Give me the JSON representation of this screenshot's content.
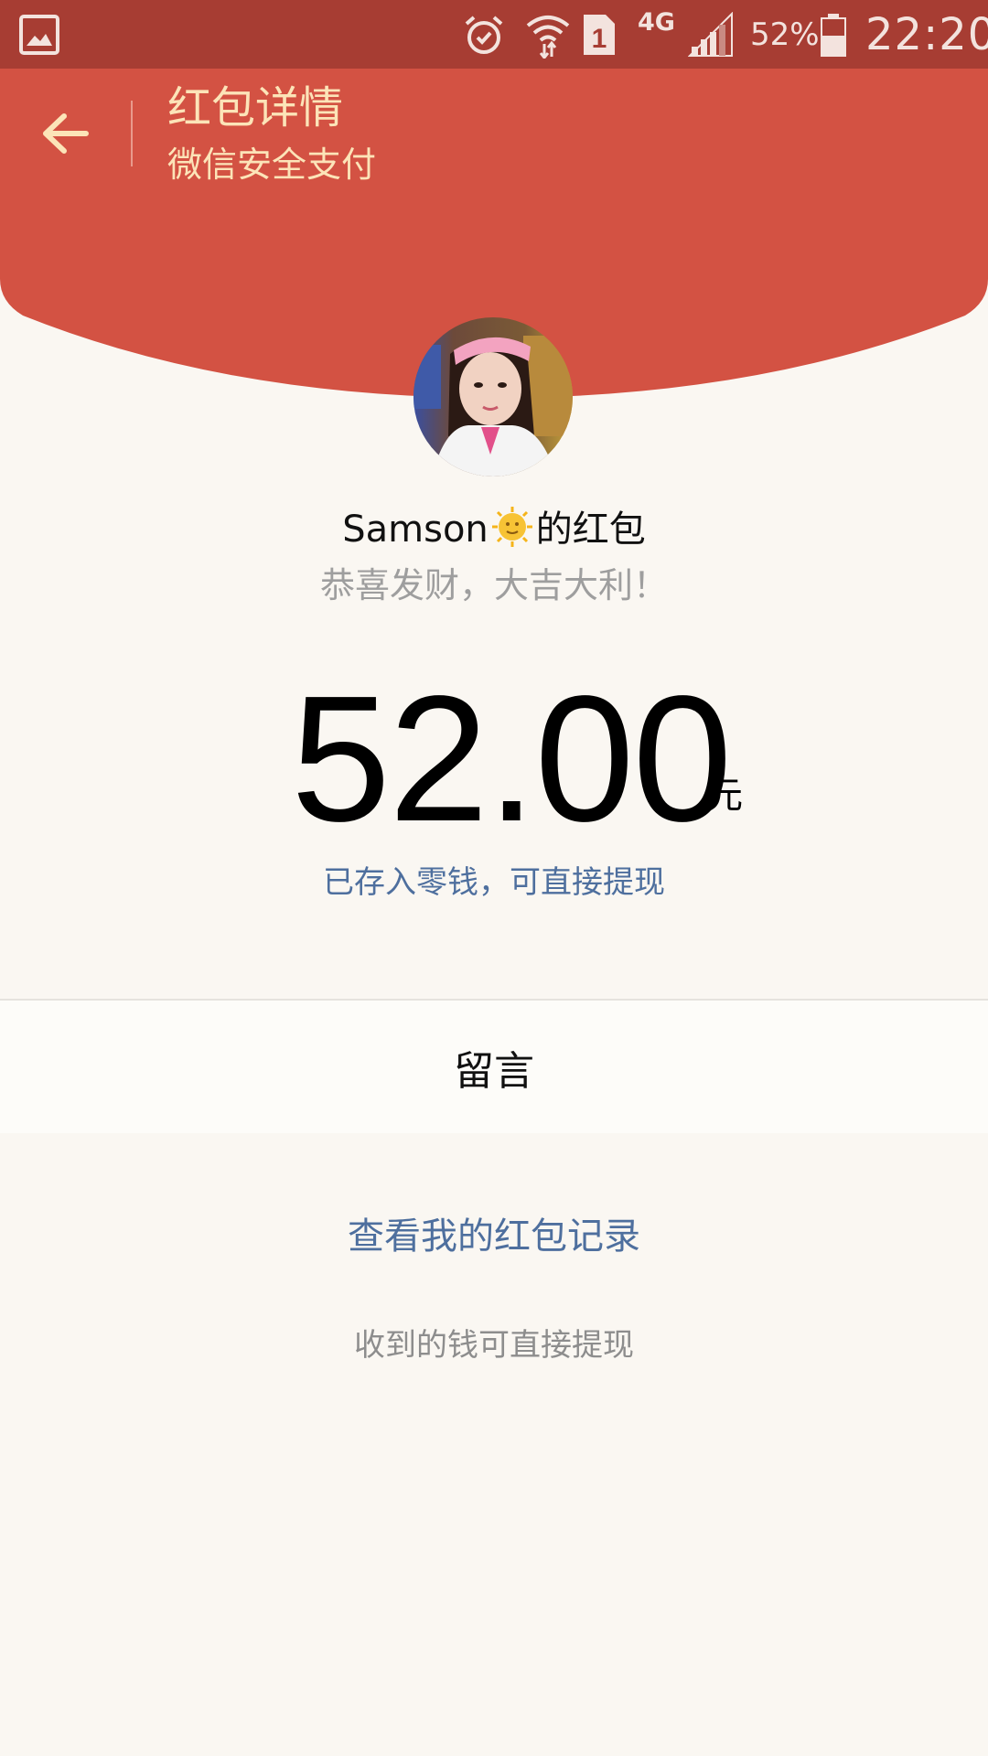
{
  "status_bar": {
    "network": "4G",
    "sim_slot": "1",
    "battery_percent": "52%",
    "battery_level": 0.52,
    "time": "22:20",
    "icons": [
      "gallery-icon",
      "alarm-icon",
      "wifi-icon",
      "sim-icon",
      "signal-icon",
      "battery-icon"
    ]
  },
  "header": {
    "title": "红包详情",
    "subtitle": "微信安全支付",
    "back_icon": "back-arrow-icon",
    "background_color": "#d35243",
    "text_color": "#fce4b8"
  },
  "envelope": {
    "sender_name": "Samson",
    "sender_emoji": "sun-face-icon",
    "sender_suffix": "的红包",
    "blessing": "恭喜发财，大吉大利！",
    "amount": "52.00",
    "currency_unit": "元",
    "deposit_note": "已存入零钱，可直接提现"
  },
  "message": {
    "label": "留言"
  },
  "footer": {
    "records_link": "查看我的红包记录",
    "note": "收到的钱可直接提现"
  },
  "colors": {
    "status_bar": "#a73d33",
    "header_red": "#d35243",
    "page_bg": "#faf7f2",
    "link_blue": "#4e6f9e"
  }
}
